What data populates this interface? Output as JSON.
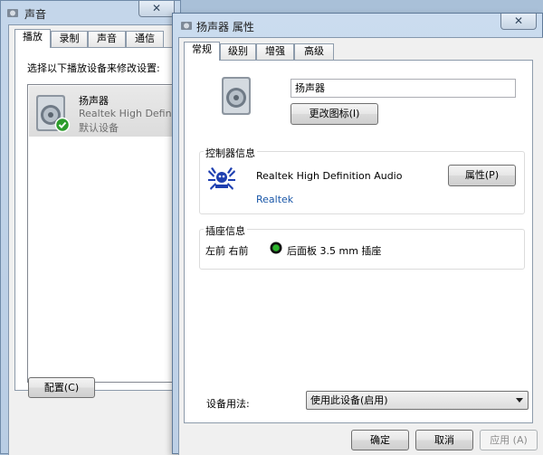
{
  "sound_window": {
    "title": "声音",
    "tabs": [
      "播放",
      "录制",
      "声音",
      "通信"
    ],
    "instruction": "选择以下播放设备来修改设置:",
    "device": {
      "name": "扬声器",
      "driver": "Realtek High Definition",
      "status": "默认设备"
    },
    "configure_label": "配置(C)",
    "close_glyph": "✕"
  },
  "props_window": {
    "title": "扬声器 属性",
    "tabs": [
      "常规",
      "级别",
      "增强",
      "高级"
    ],
    "device_name_value": "扬声器",
    "change_icon_label": "更改图标(I)",
    "controller_group": {
      "title": "控制器信息",
      "name": "Realtek High Definition Audio",
      "vendor": "Realtek",
      "properties_label": "属性(P)"
    },
    "jack_group": {
      "title": "插座信息",
      "position": "左前 右前",
      "jack": "后面板 3.5 mm 插座",
      "jack_color": "#2db52d"
    },
    "usage_label": "设备用法:",
    "usage_value": "使用此设备(启用)",
    "ok_label": "确定",
    "cancel_label": "取消",
    "apply_label": "应用 (A)",
    "close_glyph": "✕"
  }
}
